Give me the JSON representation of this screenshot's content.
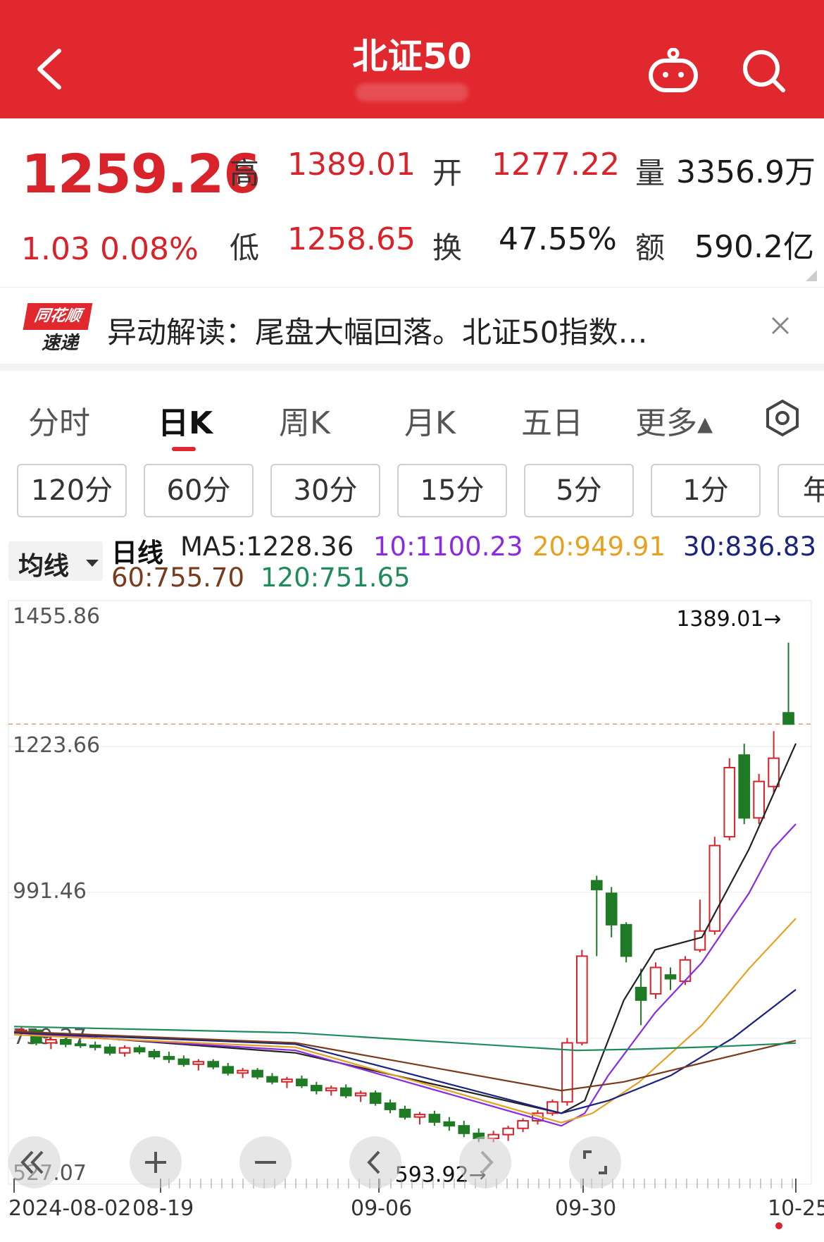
{
  "header": {
    "title": "北证50"
  },
  "quote": {
    "price": "1259.26",
    "change": "1.03",
    "change_pct": "0.08%",
    "high_label": "高",
    "high": "1389.01",
    "open_label": "开",
    "open": "1277.22",
    "volume_label": "量",
    "volume": "3356.9万",
    "low_label": "低",
    "low": "1258.65",
    "turnover_label": "换",
    "turnover": "47.55%",
    "amount_label": "额",
    "amount": "590.2亿"
  },
  "news": {
    "logo_top": "同花顺",
    "logo_bottom": "速递",
    "text": "异动解读：尾盘大幅回落。北证50指数…"
  },
  "tabs": [
    {
      "label": "分时"
    },
    {
      "label": "日K"
    },
    {
      "label": "周K"
    },
    {
      "label": "月K"
    },
    {
      "label": "五日"
    },
    {
      "label": "更多▴"
    }
  ],
  "periods": [
    {
      "label": "120分"
    },
    {
      "label": "60分"
    },
    {
      "label": "30分"
    },
    {
      "label": "15分"
    },
    {
      "label": "5分"
    },
    {
      "label": "1分"
    },
    {
      "label": "年"
    }
  ],
  "ma_legend": {
    "selector": "均线",
    "kline": "日线",
    "ma5": "MA5:1228.36",
    "ma10": "10:1100.23",
    "ma20": "20:949.91",
    "ma30": "30:836.83",
    "ma60": "60:755.70",
    "ma120": "120:751.65"
  },
  "colors": {
    "up": "#d9232a",
    "down": "#1e7a25",
    "ma5": "#222222",
    "ma10": "#8a2be2",
    "ma20": "#e8a020",
    "ma30": "#1a237e",
    "ma60": "#7a3b1c",
    "ma120": "#1f8a5a"
  },
  "chart_data": {
    "type": "candlestick",
    "y_ticks": [
      "1455.86",
      "1223.66",
      "991.46",
      "759.27",
      "527.07"
    ],
    "ylim": [
      527.07,
      1455.86
    ],
    "x_ticks": [
      "2024-08-02",
      "08-19",
      "09-06",
      "09-30",
      "10-25"
    ],
    "max_label": "1389.01→",
    "min_label": "593.92→",
    "last_close": 1259.26,
    "ohlc": [
      [
        770,
        778,
        766,
        772
      ],
      [
        772,
        774,
        748,
        752
      ],
      [
        752,
        762,
        742,
        757
      ],
      [
        757,
        760,
        745,
        750
      ],
      [
        750,
        756,
        744,
        748
      ],
      [
        748,
        754,
        740,
        745
      ],
      [
        745,
        750,
        732,
        736
      ],
      [
        736,
        748,
        730,
        744
      ],
      [
        744,
        748,
        734,
        738
      ],
      [
        738,
        742,
        726,
        730
      ],
      [
        730,
        738,
        720,
        726
      ],
      [
        726,
        732,
        714,
        718
      ],
      [
        718,
        726,
        708,
        722
      ],
      [
        722,
        726,
        710,
        714
      ],
      [
        714,
        720,
        700,
        704
      ],
      [
        704,
        712,
        696,
        708
      ],
      [
        708,
        712,
        694,
        698
      ],
      [
        698,
        704,
        686,
        690
      ],
      [
        690,
        698,
        680,
        694
      ],
      [
        694,
        700,
        680,
        684
      ],
      [
        684,
        690,
        670,
        676
      ],
      [
        676,
        684,
        668,
        680
      ],
      [
        680,
        686,
        664,
        668
      ],
      [
        668,
        676,
        658,
        672
      ],
      [
        672,
        676,
        652,
        656
      ],
      [
        656,
        662,
        640,
        646
      ],
      [
        646,
        652,
        630,
        634
      ],
      [
        634,
        642,
        622,
        638
      ],
      [
        638,
        644,
        620,
        626
      ],
      [
        626,
        634,
        612,
        620
      ],
      [
        620,
        628,
        602,
        608
      ],
      [
        608,
        616,
        594,
        600
      ],
      [
        600,
        612,
        593.92,
        606
      ],
      [
        606,
        620,
        596,
        616
      ],
      [
        616,
        632,
        610,
        628
      ],
      [
        628,
        645,
        622,
        640
      ],
      [
        640,
        662,
        636,
        658
      ],
      [
        658,
        760,
        652,
        752
      ],
      [
        752,
        900,
        748,
        890
      ],
      [
        1010,
        1018,
        890,
        996
      ],
      [
        990,
        1000,
        920,
        940
      ],
      [
        940,
        944,
        880,
        890
      ],
      [
        840,
        870,
        780,
        820
      ],
      [
        830,
        880,
        822,
        872
      ],
      [
        860,
        872,
        836,
        854
      ],
      [
        850,
        890,
        844,
        884
      ],
      [
        900,
        980,
        896,
        930
      ],
      [
        930,
        1080,
        924,
        1066
      ],
      [
        1080,
        1205,
        1074,
        1190
      ],
      [
        1210,
        1228,
        1100,
        1110
      ],
      [
        1110,
        1180,
        1100,
        1168
      ],
      [
        1160,
        1248,
        1150,
        1205
      ],
      [
        1277.22,
        1389.01,
        1258.65,
        1259.26
      ]
    ],
    "ma": {
      "ma5": [
        [
          0.0,
          770
        ],
        [
          0.36,
          736
        ],
        [
          0.7,
          640
        ],
        [
          0.73,
          660
        ],
        [
          0.78,
          820
        ],
        [
          0.82,
          900
        ],
        [
          0.88,
          920
        ],
        [
          0.94,
          1060
        ],
        [
          1.0,
          1228.36
        ]
      ],
      "ma10": [
        [
          0.0,
          768
        ],
        [
          0.36,
          740
        ],
        [
          0.7,
          620
        ],
        [
          0.73,
          640
        ],
        [
          0.76,
          700
        ],
        [
          0.82,
          800
        ],
        [
          0.88,
          880
        ],
        [
          0.94,
          990
        ],
        [
          0.97,
          1060
        ],
        [
          1.0,
          1100.23
        ]
      ],
      "ma20": [
        [
          0.0,
          765
        ],
        [
          0.36,
          745
        ],
        [
          0.7,
          625
        ],
        [
          0.74,
          640
        ],
        [
          0.8,
          690
        ],
        [
          0.88,
          780
        ],
        [
          0.94,
          870
        ],
        [
          1.0,
          949.91
        ]
      ],
      "ma30": [
        [
          0.0,
          768
        ],
        [
          0.36,
          750
        ],
        [
          0.7,
          640
        ],
        [
          0.76,
          660
        ],
        [
          0.84,
          700
        ],
        [
          0.92,
          760
        ],
        [
          1.0,
          836.83
        ]
      ],
      "ma60": [
        [
          0.0,
          770
        ],
        [
          0.36,
          752
        ],
        [
          0.7,
          676
        ],
        [
          0.78,
          690
        ],
        [
          0.88,
          720
        ],
        [
          1.0,
          755.7
        ]
      ],
      "ma120": [
        [
          0.0,
          778
        ],
        [
          0.36,
          768
        ],
        [
          0.72,
          740
        ],
        [
          0.8,
          742
        ],
        [
          0.9,
          746
        ],
        [
          1.0,
          751.65
        ]
      ]
    }
  }
}
